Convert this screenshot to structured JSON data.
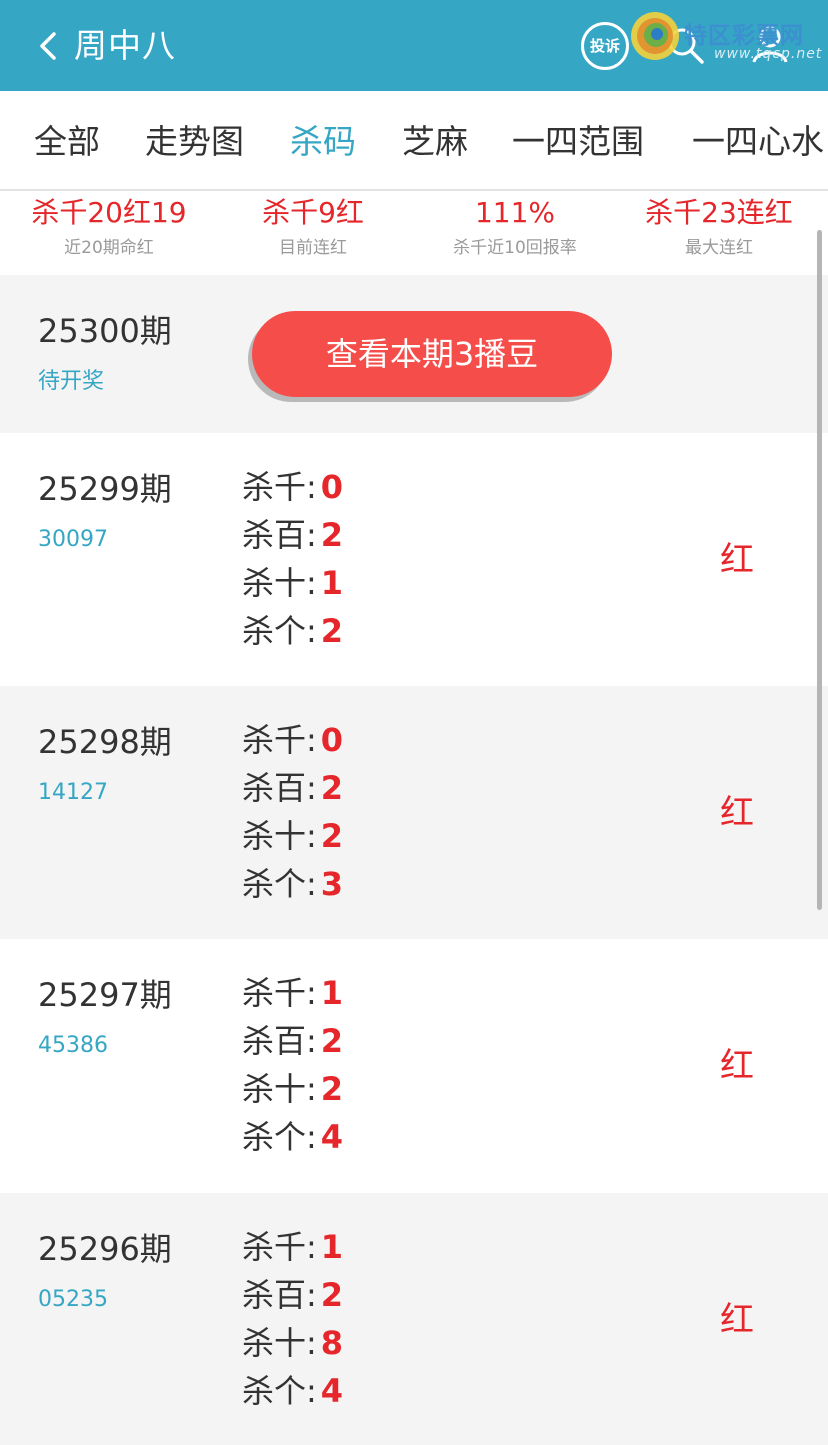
{
  "header": {
    "title": "周中八",
    "complain_label": "投诉",
    "watermark_text": "特区彩票网",
    "watermark_url": "www.tqcp.net",
    "bg_color": "#35a6c4"
  },
  "tabs": [
    {
      "label": "全部"
    },
    {
      "label": "走势图"
    },
    {
      "label": "杀码",
      "active": true
    },
    {
      "label": "芝麻"
    },
    {
      "label": "一四范围"
    },
    {
      "label": "一四心水"
    }
  ],
  "stats": [
    {
      "value": "杀千20红19",
      "label": "近20期命红"
    },
    {
      "value": "杀千9红",
      "label": "目前连红"
    },
    {
      "value": "111%",
      "label": "杀千近10回报率"
    },
    {
      "value": "杀千23连红",
      "label": "最大连红"
    }
  ],
  "current": {
    "issue": "25300期",
    "status": "待开奖",
    "button_label": "查看本期3播豆"
  },
  "kill_labels": {
    "qian": "杀千:",
    "bai": "杀百:",
    "shi": "杀十:",
    "ge": "杀个:"
  },
  "history": [
    {
      "issue": "25299期",
      "number": "30097",
      "qian": "0",
      "bai": "2",
      "shi": "1",
      "ge": "2",
      "result": "红"
    },
    {
      "issue": "25298期",
      "number": "14127",
      "qian": "0",
      "bai": "2",
      "shi": "2",
      "ge": "3",
      "result": "红"
    },
    {
      "issue": "25297期",
      "number": "45386",
      "qian": "1",
      "bai": "2",
      "shi": "2",
      "ge": "4",
      "result": "红"
    },
    {
      "issue": "25296期",
      "number": "05235",
      "qian": "1",
      "bai": "2",
      "shi": "8",
      "ge": "4",
      "result": "红"
    }
  ],
  "colors": {
    "accent": "#35a6c4",
    "red": "#e5262a",
    "button": "#f54d4a"
  },
  "icons": {
    "back": "chevron-left-icon",
    "search": "search-icon",
    "user": "user-icon",
    "logo": "swirl-logo-icon"
  }
}
